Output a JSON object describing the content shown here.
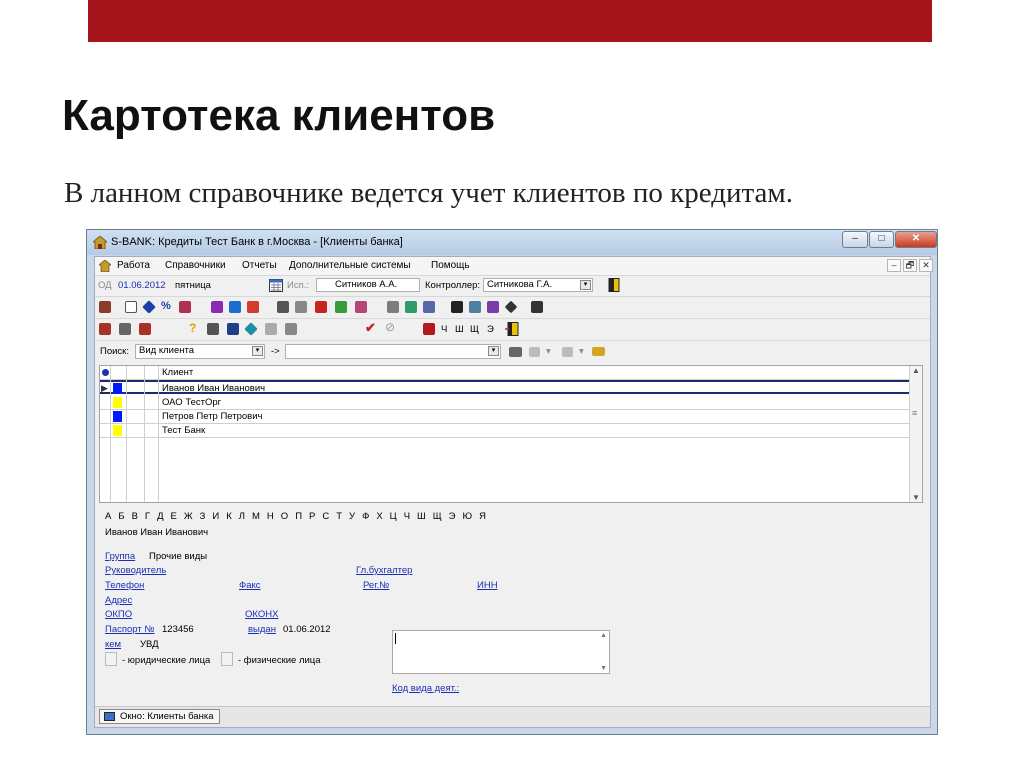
{
  "slide": {
    "title": "Картотека клиентов",
    "subtitle": "В ланном справочнике ведется учет клиентов по кредитам."
  },
  "window": {
    "title": "S-BANK: Кредиты Тест Банк в г.Москва - [Клиенты банка]",
    "controls": {
      "minimize": "–",
      "maximize": "□",
      "close": "✕"
    },
    "mdi_controls": {
      "minimize": "–",
      "restore": "🗗",
      "close": "✕"
    }
  },
  "menu": [
    "Работа",
    "Справочники",
    "Отчеты",
    "Дополнительные системы",
    "Помощь"
  ],
  "odbar": {
    "od_label": "ОД",
    "date": "01.06.2012",
    "weekday": "пятница",
    "isp_label": "Исп.:",
    "isp_value": "Ситников А.А.",
    "controller_label": "Контроллер:",
    "controller_value": "Ситникова Г.А."
  },
  "toolbar3_letters": [
    "Ч",
    "Ш",
    "Щ",
    "Э"
  ],
  "search": {
    "label": "Поиск:",
    "field_select": "Вид клиента",
    "arrow": "->",
    "value": "",
    "dropdown_arrow": "▾"
  },
  "grid": {
    "header": "Клиент",
    "rows": [
      {
        "name": "Иванов Иван Иванович",
        "color": "#0019ff",
        "selected": true
      },
      {
        "name": "ОАО ТестОрг",
        "color": "#ffff00",
        "selected": false
      },
      {
        "name": "Петров Петр Петрович",
        "color": "#0019ff",
        "selected": false
      },
      {
        "name": "Тест Банк",
        "color": "#ffff00",
        "selected": false
      }
    ]
  },
  "alphabet": [
    "А",
    "Б",
    "В",
    "Г",
    "Д",
    "Е",
    "Ж",
    "З",
    "И",
    "К",
    "Л",
    "М",
    "Н",
    "О",
    "П",
    "Р",
    "С",
    "Т",
    "У",
    "Ф",
    "Х",
    "Ц",
    "Ч",
    "Ш",
    "Щ",
    "Э",
    "Ю",
    "Я"
  ],
  "details": {
    "client_name": "Иванов Иван Иванович",
    "group_label": "Группа",
    "group_value": "Прочие виды",
    "director_label": "Руководитель",
    "chief_accountant_label": "Гл.бухгалтер",
    "phone_label": "Телефон",
    "fax_label": "Факс",
    "reg_label": "Рег.№",
    "inn_label": "ИНН",
    "address_label": "Адрес",
    "okpo_label": "ОКПО",
    "okonh_label": "ОКОНХ",
    "passport_label": "Паспорт №",
    "passport_value": "123456",
    "issued_label": "выдан",
    "issued_value": "01.06.2012",
    "by_whom_label": "кем",
    "by_whom_value": "УВД",
    "legal_label": "- юридические лица",
    "physical_label": "- физические лица",
    "activity_code_label": "Код вида деят.:"
  },
  "statusbar": {
    "window_button": "Окно: Клиенты банка"
  },
  "colors": {
    "brand_bar": "#a6141b",
    "marker_blue": "#0019ff",
    "marker_yellow": "#ffff00"
  }
}
